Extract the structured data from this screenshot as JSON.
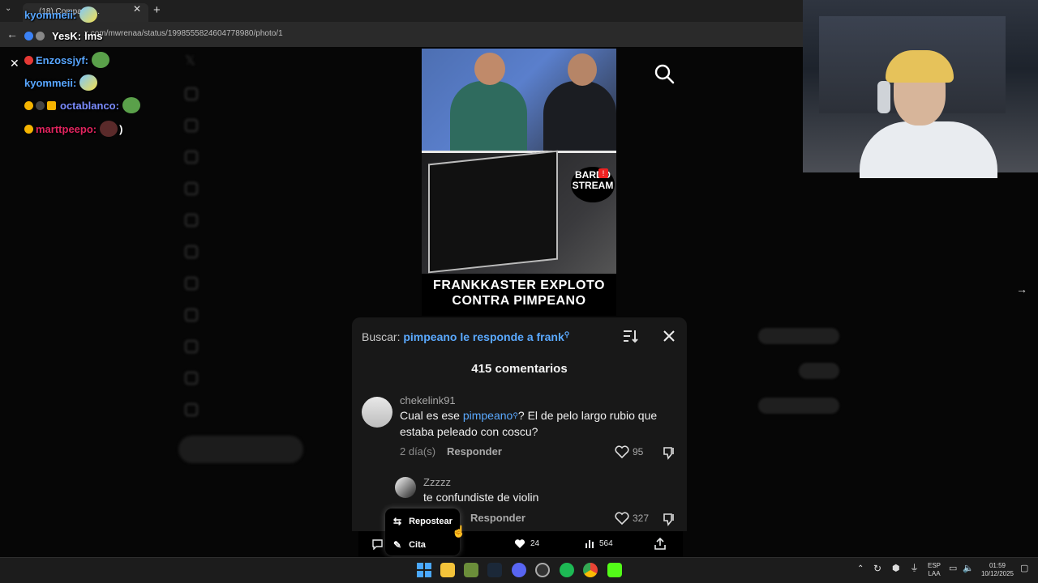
{
  "browser": {
    "tab_title": "(18) Compartid...",
    "url": "x.com/mwrenaa/status/1998555824604778980/photo/1"
  },
  "chat": {
    "lines": [
      {
        "user": "kyommeii:",
        "color": "#58a6ff",
        "text": ""
      },
      {
        "user": "YesK:",
        "color": "#ffffff",
        "text": "lms"
      },
      {
        "user": "Enzossjyf:",
        "color": "#58a6ff",
        "text": ""
      },
      {
        "user": "kyommeii:",
        "color": "#58a6ff",
        "text": ""
      },
      {
        "user": "octablanco:",
        "color": "#7b8cff",
        "text": ""
      },
      {
        "user": "marttpeepo:",
        "color": "#e0245e",
        "text": ")"
      }
    ]
  },
  "video": {
    "title": "FRANKKASTER EXPLOTO CONTRA PIMPEANO",
    "watermark_line1": "BARDO",
    "watermark_line2": "STREAM",
    "watermark_badge": "!"
  },
  "comments_panel": {
    "search_prefix": "Buscar:",
    "search_query": "pimpeano le responde a frank",
    "count_label": "415 comentarios",
    "comments": [
      {
        "username": "chekelink91",
        "text_before": "Cual es ese ",
        "text_link": "pimpeano",
        "text_after": "? El de pelo largo rubio que estaba peleado con coscu?",
        "time": "2 día(s)",
        "reply_label": "Responder",
        "likes": "95"
      },
      {
        "username": "Zzzzz",
        "text": "te confundiste de violin",
        "reply_label": "Responder",
        "likes": "327"
      }
    ]
  },
  "action_bar": {
    "likes": "24",
    "views": "564",
    "repost_label": "Repostear",
    "quote_label": "Cita"
  },
  "taskbar": {
    "lang_top": "ESP",
    "lang_bottom": "LAA",
    "time": "01:59",
    "date": "10/12/2025"
  },
  "colors": {
    "link": "#5aa9ff",
    "panel_bg": "#181818"
  }
}
